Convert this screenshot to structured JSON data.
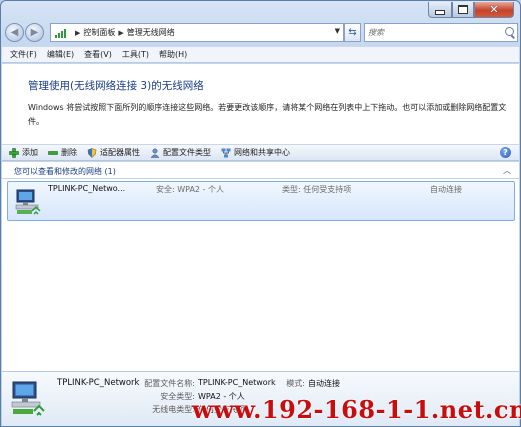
{
  "window": {
    "caption_buttons": {
      "minimize": "minimize-icon",
      "maximize": "maximize-icon",
      "close": "close-icon"
    }
  },
  "nav": {
    "breadcrumb": [
      "控制面板",
      "管理无线网络"
    ],
    "search_placeholder": "搜索"
  },
  "menu": [
    "文件(F)",
    "编辑(E)",
    "查看(V)",
    "工具(T)",
    "帮助(H)"
  ],
  "header": {
    "title": "管理使用(无线网络连接 3)的无线网络",
    "description": "Windows 将尝试按照下面所列的顺序连接这些网络。若要更改该顺序，请将某个网络在列表中上下拖动。也可以添加或删除网络配置文件。"
  },
  "toolbar": {
    "items": [
      {
        "label": "添加",
        "icon": "add-icon"
      },
      {
        "label": "删除",
        "icon": "remove-icon"
      },
      {
        "label": "适配器属性",
        "icon": "adapter-shield-icon"
      },
      {
        "label": "配置文件类型",
        "icon": "profile-user-icon"
      },
      {
        "label": "网络和共享中心",
        "icon": "network-center-icon"
      }
    ],
    "help_icon": "help-icon"
  },
  "list": {
    "group_title": "您可以查看和修改的网络 (1)",
    "networks": [
      {
        "name": "TPLINK-PC_Netwo...",
        "security": "安全: WPA2 - 个人",
        "type": "类型: 任何受支持项",
        "mode": "自动连接"
      }
    ]
  },
  "details": {
    "name": "TPLINK-PC_Network",
    "profile_label": "配置文件名称:",
    "profile_value": "TPLINK-PC_Network",
    "mode_label": "模式:",
    "mode_value": "自动连接",
    "security_label": "安全类型:",
    "security_value": "WPA2 - 个人",
    "radio_label": "无线电类型:",
    "radio_value": "任何受支持项"
  },
  "watermark": "www.192-168-1-1.net.cn",
  "colors": {
    "accent_heading": "#1a3e82",
    "selection_fill": "#d5e6fb",
    "watermark": "#c70e0e"
  }
}
